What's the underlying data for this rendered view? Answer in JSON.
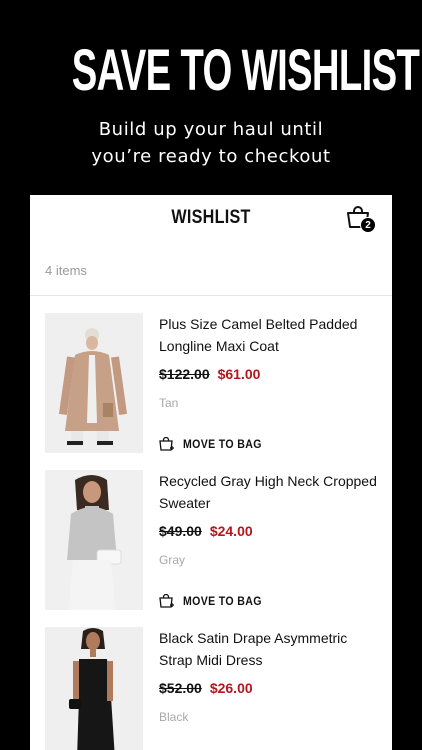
{
  "hero": {
    "title": "SAVE TO WISHLIST",
    "subtitle_line1": "Build up your haul until",
    "subtitle_line2": "you’re ready to checkout"
  },
  "wishlist": {
    "title": "WISHLIST",
    "bag_count": "2",
    "item_count": "4 items",
    "move_label": "MOVE TO BAG"
  },
  "items": [
    {
      "name": "Plus Size Camel Belted Padded Longline Maxi Coat",
      "old_price": "$122.00",
      "new_price": "$61.00",
      "color": "Tan",
      "move_label": "MOVE TO BAG"
    },
    {
      "name": "Recycled Gray High Neck Cropped Sweater",
      "old_price": "$49.00",
      "new_price": "$24.00",
      "color": "Gray",
      "move_label": "MOVE TO BAG"
    },
    {
      "name": "Black Satin Drape Asymmetric Strap Midi Dress",
      "old_price": "$52.00",
      "new_price": "$26.00",
      "color": "Black"
    }
  ],
  "colors": {
    "sale": "#b5161f",
    "background": "#000000",
    "card": "#ffffff"
  },
  "icons": [
    "shopping-bag-icon",
    "bag-add-icon"
  ]
}
